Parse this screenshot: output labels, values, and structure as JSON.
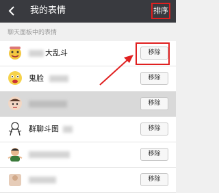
{
  "header": {
    "title": "我的表情",
    "sort_label": "排序"
  },
  "section_title": "聊天面板中的表情",
  "rows": [
    {
      "name": "大乱斗",
      "remove_label": "移除"
    },
    {
      "name": "鬼脸",
      "remove_label": "移除"
    },
    {
      "name": "",
      "remove_label": "移除"
    },
    {
      "name": "群聊斗图",
      "remove_label": "移除"
    },
    {
      "name": "",
      "remove_label": "移除"
    },
    {
      "name": "",
      "remove_label": "移除"
    }
  ],
  "colors": {
    "topbar": "#393a3f",
    "highlight": "#e02020",
    "background": "#f0f0f0"
  }
}
